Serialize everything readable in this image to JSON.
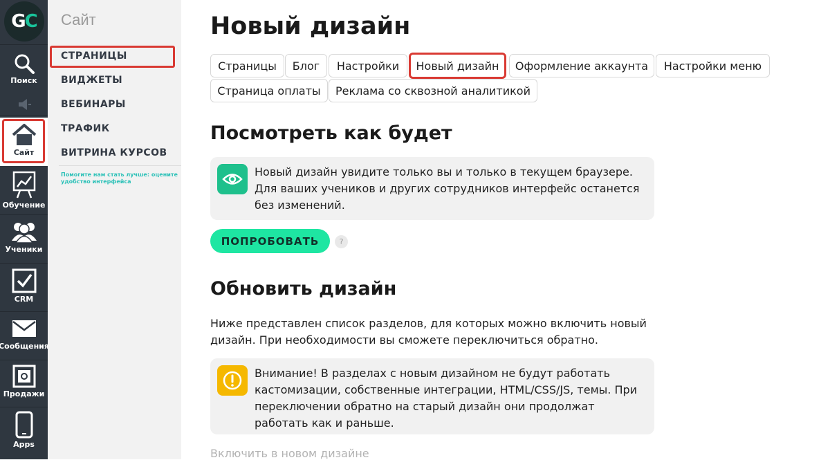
{
  "rail": {
    "logo": "GC",
    "items": [
      {
        "label": "Поиск",
        "icon": "search-icon"
      },
      {
        "label": "Сайт",
        "icon": "home-icon"
      },
      {
        "label": "Обучение",
        "icon": "easel-chart-icon"
      },
      {
        "label": "Ученики",
        "icon": "users-icon"
      },
      {
        "label": "CRM",
        "icon": "checkbox-icon"
      },
      {
        "label": "Сообщения",
        "icon": "envelope-icon"
      },
      {
        "label": "Продажи",
        "icon": "safe-icon"
      },
      {
        "label": "Apps",
        "icon": "phone-icon"
      }
    ],
    "colors": {
      "background": "#2f3740",
      "highlight": "#d93a33"
    }
  },
  "subnav": {
    "title": "Сайт",
    "items": [
      "СТРАНИЦЫ",
      "ВИДЖЕТЫ",
      "ВЕБИНАРЫ",
      "ТРАФИК",
      "ВИТРИНА КУРСОВ"
    ],
    "feedback": "Помогите нам стать лучше: оцените удобство интерфейса"
  },
  "main": {
    "title": "Новый дизайн",
    "tabs": [
      "Страницы",
      "Блог",
      "Настройки",
      "Новый дизайн",
      "Оформление аккаунта",
      "Настройки меню",
      "Страница оплаты",
      "Реклама со сквозной аналитикой"
    ],
    "active_tab": "Новый дизайн",
    "preview": {
      "heading": "Посмотреть как будет",
      "note": "Новый дизайн увидите только вы и только в текущем браузере. Для ваших учеников и других сотрудников интерфейс останется без изменений.",
      "button": "ПОПРОБОВАТЬ",
      "help": "?"
    },
    "update": {
      "heading": "Обновить дизайн",
      "text": "Ниже представлен список разделов, для которых можно включить новый дизайн. При необходимости вы сможете переключиться обратно.",
      "warning": "Внимание! В разделах с новым дизайном не будут работать кастомизации, собственные интеграции, HTML/CSS/JS, темы. При переключении обратно на старый дизайн они продолжат работать как и раньше.",
      "enable_label": "Включить в новом дизайне"
    },
    "colors": {
      "accent": "#1ee6a2",
      "eye_icon_bg": "#1ec08c",
      "warning_icon_bg": "#f5b800"
    }
  }
}
